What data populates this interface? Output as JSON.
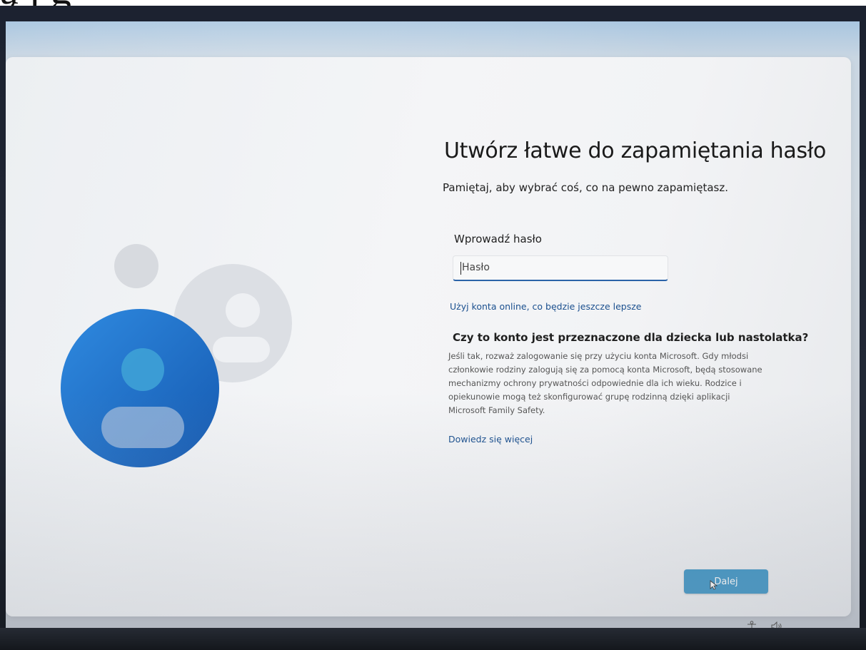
{
  "overlay_text": "ą  j g",
  "setup": {
    "title": "Utwórz łatwe do zapamiętania hasło",
    "subtitle": "Pamiętaj, aby wybrać coś, co na pewno zapamiętasz.",
    "password_label": "Wprowadź hasło",
    "password_placeholder": "Hasło",
    "password_value": "",
    "online_account_link": "Użyj konta online, co będzie jeszcze lepsze",
    "child_heading": "Czy to konto jest przeznaczone dla dziecka lub nastolatka?",
    "child_body_lines": [
      "Jeśli tak, rozważ zalogowanie się przy użyciu konta Microsoft. Gdy młodsi",
      "członkowie rodziny zalogują się za pomocą konta Microsoft, będą stosowane",
      "mechanizmy ochrony prywatności odpowiednie dla ich wieku. Rodzice i",
      "opiekunowie mogą też skonfigurować grupę rodzinną dzięki aplikacji",
      "Microsoft Family Safety."
    ],
    "learn_more_link": "Dowiedz się więcej",
    "next_button": "Dalej"
  },
  "icons": {
    "taskbar": [
      "accessibility-icon",
      "volume-icon"
    ]
  },
  "colors": {
    "accent_button": "#3a93c4",
    "link": "#1a4f8e",
    "input_underline": "#2a63a8",
    "avatar_blue": "#1e6fc8"
  }
}
